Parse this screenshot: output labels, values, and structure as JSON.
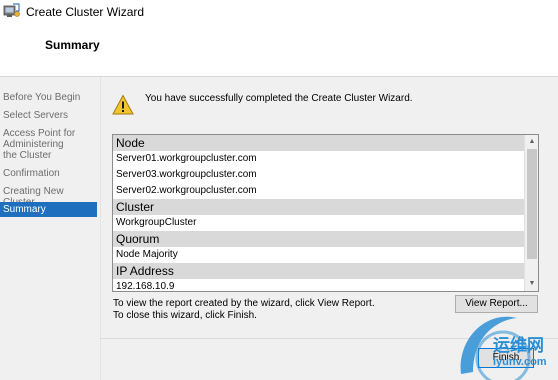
{
  "window": {
    "title": "Create Cluster Wizard",
    "icon": "cluster-wizard-icon"
  },
  "header": {
    "heading": "Summary"
  },
  "sidebar": {
    "items": [
      {
        "label": "Before You Begin",
        "active": false
      },
      {
        "label": "Select Servers",
        "active": false
      },
      {
        "label": "Access Point for Administering the Cluster",
        "active": false
      },
      {
        "label": "Confirmation",
        "active": false
      },
      {
        "label": "Creating New Cluster",
        "active": false
      },
      {
        "label": "Summary",
        "active": true
      }
    ]
  },
  "main": {
    "message": "You have successfully completed the Create Cluster Wizard.",
    "report": {
      "sections": [
        {
          "title": "Node",
          "items": [
            "Server01.workgroupcluster.com",
            "Server03.workgroupcluster.com",
            "Server02.workgroupcluster.com"
          ]
        },
        {
          "title": "Cluster",
          "items": [
            "WorkgroupCluster"
          ]
        },
        {
          "title": "Quorum",
          "items": [
            "Node Majority"
          ]
        },
        {
          "title": "IP Address",
          "items": [
            "192.168.10.9"
          ]
        }
      ]
    },
    "hint_view": "To view the report created by the wizard, click View Report.",
    "hint_close": "To close this wizard, click Finish.",
    "view_report_label": "View Report...",
    "finish_label": "Finish"
  },
  "watermark": {
    "text_cn": "运维网",
    "text_url": "iyunv.com"
  },
  "colors": {
    "selection": "#1f6fbf",
    "section_bg": "#d9d9d9",
    "panel_bg": "#f0f0f0",
    "watermark": "#2c8fd6"
  }
}
